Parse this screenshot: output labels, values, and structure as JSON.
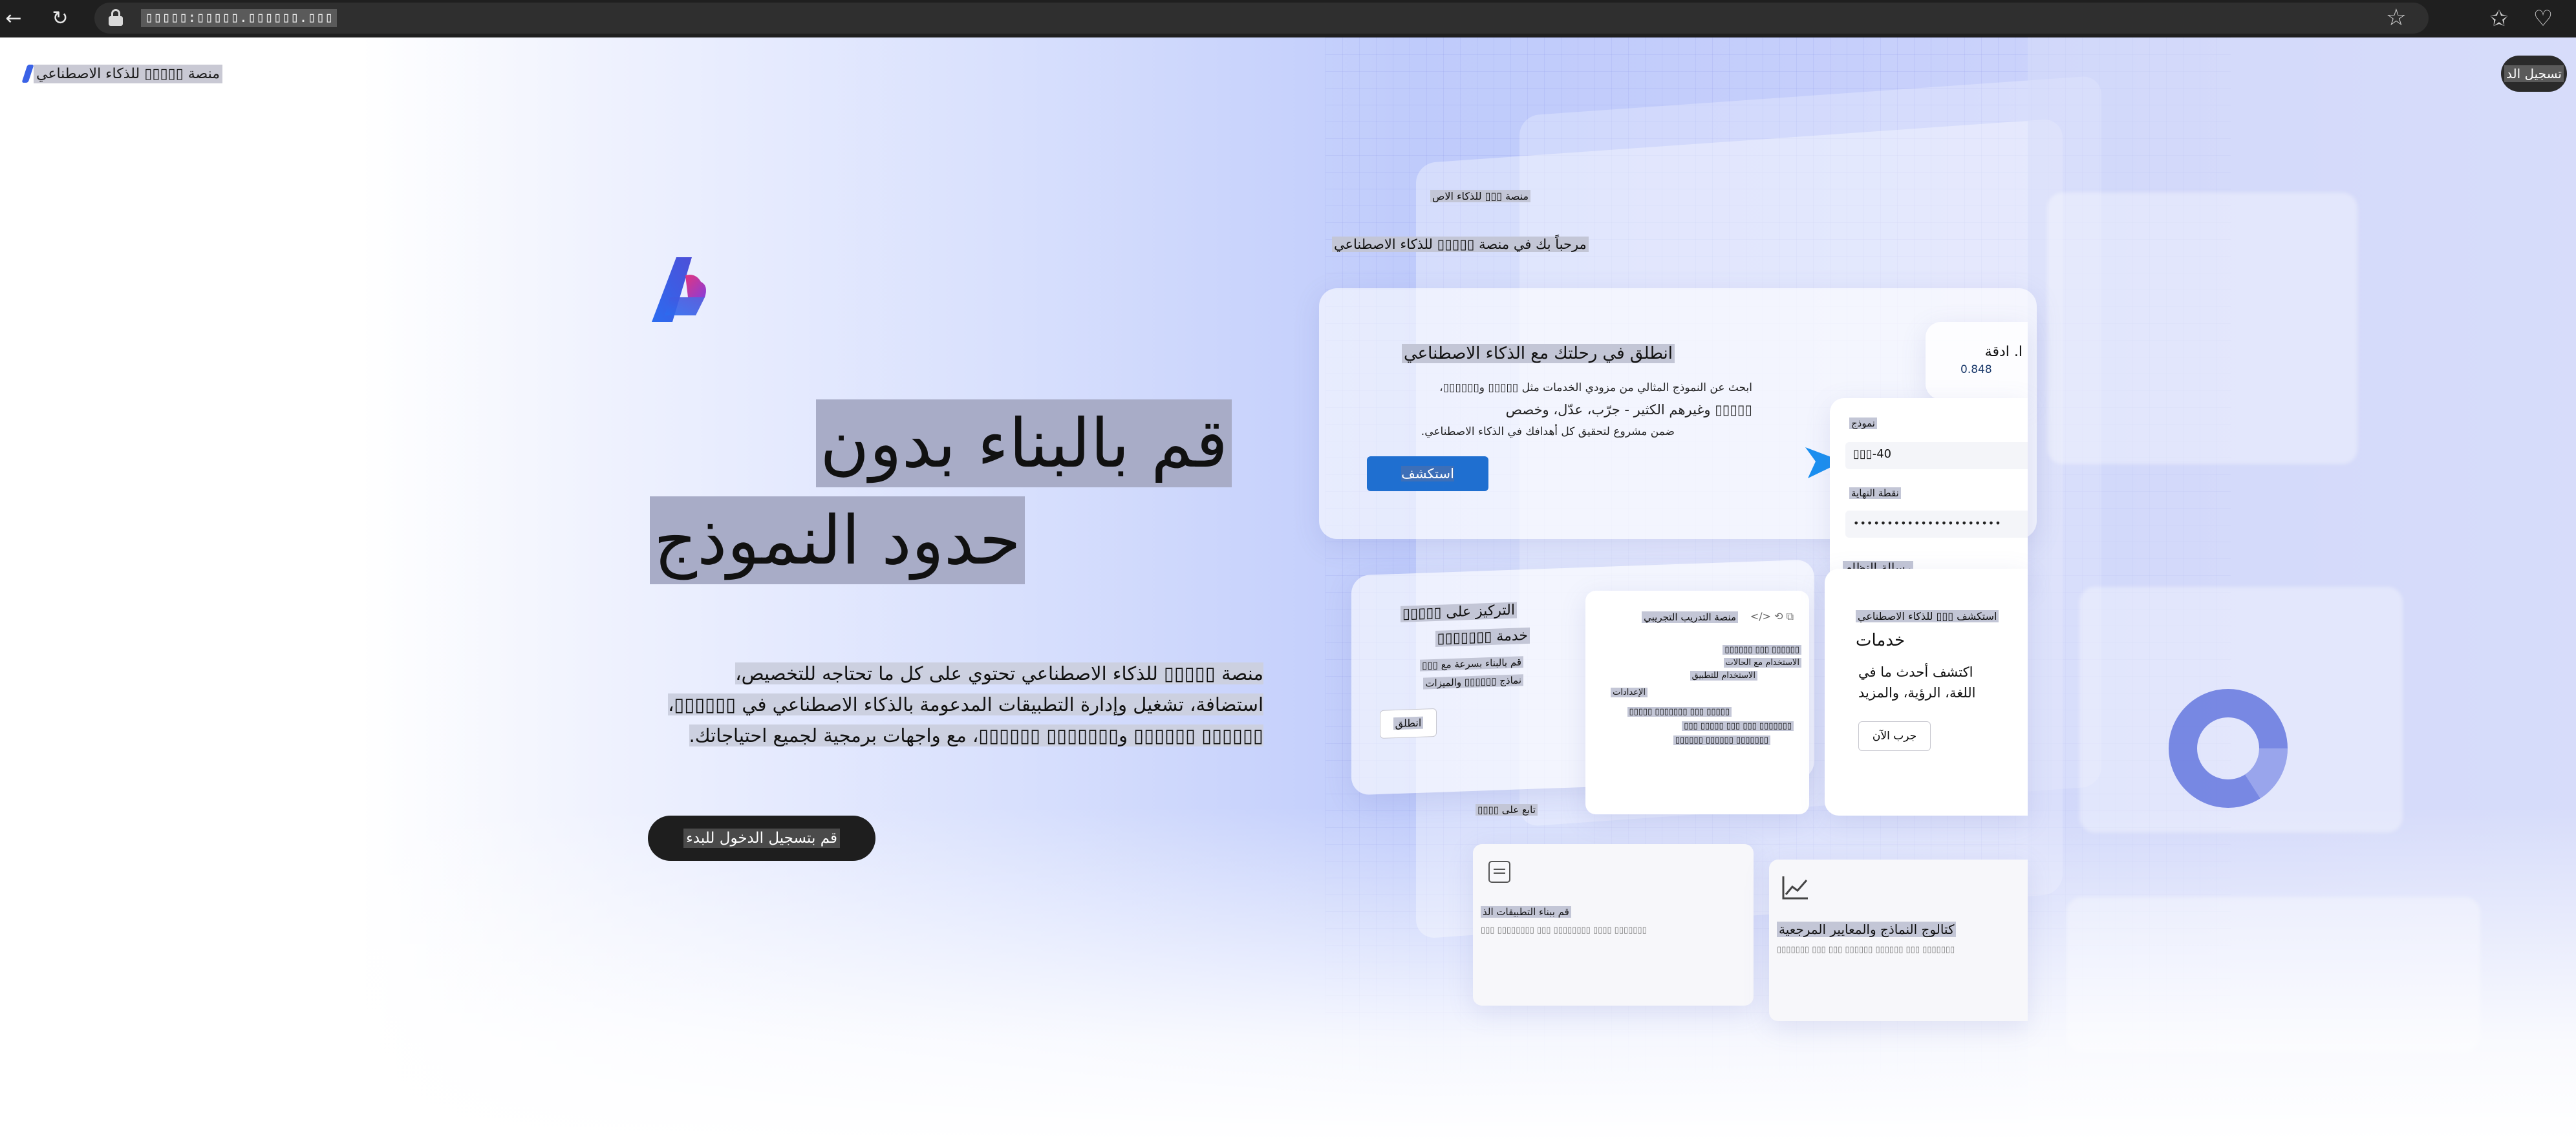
{
  "browser": {
    "url": "▯▯▯▯▯:▯▯▯▯▯.▯▯▯▯▯▯.▯▯▯",
    "back_icon": "←",
    "reload_icon": "↻",
    "favorite_icon": "☆",
    "favorites_icon": "✩",
    "extensions_icon": "♡"
  },
  "header": {
    "brand_label": "منصة ▯▯▯▯▯ للذكاء الاصطناعي",
    "signin_label": "تسجيل الد"
  },
  "hero": {
    "headline_line1": "قم بالبناء بدون",
    "headline_line2": "حدود النموذج",
    "description_line1": "منصة ▯▯▯▯▯ للذكاء الاصطناعي تحتوي على كل ما تحتاجه للتخصيص،",
    "description_line2": "استضافة، تشغيل وإدارة التطبيقات المدعومة بالذكاء الاصطناعي في ▯▯▯▯▯▯،",
    "description_line3": "▯▯▯▯▯▯ ▯▯▯▯▯▯ و▯▯▯▯▯▯▯ ▯▯▯▯▯▯، مع واجهات برمجية لجميع احتياجاتك.",
    "cta_label": "قم بتسجيل الدخول للبدء"
  },
  "illustration": {
    "top_small_label": "منصة ▯▯▯ للذكاء الاص",
    "welcome_text": "مرحباً بك في منصة ▯▯▯▯▯ للذكاء الاصطناعي",
    "journey": {
      "title": "انطلق في رحلتك مع الذكاء الاصطناعي",
      "desc_line1": "ابحث عن النموذج المثالي من مزودي الخدمات مثل ▯▯▯▯▯ و▯▯▯▯▯▯،",
      "desc_line2": "▯▯▯▯▯ وغيرهم الكثير - جرّب، عدّل، وخصص",
      "desc_line3": "ضمن مشروع لتحقيق كل أهدافك في الذكاء الاصطناعي.",
      "explore_button": "استكشف"
    },
    "metric": {
      "label": "ا. ادقة",
      "value": "0.848"
    },
    "model_panel": {
      "model_label": "نموذج",
      "model_value": "▯▯▯-40",
      "key_label": "نقطة النهاية",
      "key_value": "••••••••••••••••••••••",
      "system_label": "رسالة النظام"
    },
    "focus_card": {
      "title_line1": "التركيز على ▯▯▯▯▯",
      "title_line2": "خدمة ▯▯▯▯▯▯▯",
      "desc_line1": "قم بالبناء بسرعة مع ▯▯▯",
      "desc_line2": "نماذج ▯▯▯▯▯▯ والميزات",
      "button": "انطلق"
    },
    "playground_card": {
      "title": "منصة التدريب التجريبي",
      "text_line1": "▯▯▯▯▯▯ ▯▯▯ ▯▯▯▯▯▯",
      "text_line2": "الاستخدام مع الحالات",
      "text_line3": "الاستخدام للتطبيق",
      "section_label": "الإعدادات",
      "bottom_line1": "▯▯▯▯▯ ▯▯▯ ▯▯▯▯▯▯▯ ▯▯▯▯▯",
      "bottom_line2": "▯▯▯▯▯▯▯ ▯▯▯ ▯▯▯ ▯▯▯▯▯ ▯▯▯",
      "bottom_line3": "▯▯▯▯▯▯▯ ▯▯▯▯▯▯ ▯▯▯▯▯▯"
    },
    "services_card": {
      "title_line1": "استكشف ▯▯▯ للذكاء الاصطناعي",
      "title_line2": "خدمات",
      "desc_line1": "اكتشف أحدث ما في",
      "desc_line2": "اللغة، الرؤية، والمزيد",
      "button": "جرب الآن"
    },
    "continue_label": "تابع على ▯▯▯▯",
    "apps_card": {
      "title": "قم ببناء التطبيقات الذ",
      "sub": "▯▯▯▯▯▯▯ ▯▯▯▯ ▯▯▯▯▯▯▯▯ ▯▯▯ ▯▯▯▯▯▯▯▯ ▯▯▯"
    },
    "catalog_card": {
      "title": "كتالوج النماذج والمعايير المرجعية",
      "sub": "▯▯▯▯▯▯▯ ▯▯▯ ▯▯▯▯▯▯ ▯▯▯▯▯▯ ▯▯▯ ▯▯▯ ▯▯▯▯▯▯▯"
    }
  },
  "colors": {
    "primary_button": "#1f6fd0",
    "accent_arrow": "#1a8ff0",
    "logo_blue": "#2f5ce8",
    "logo_pink": "#d43d86"
  }
}
